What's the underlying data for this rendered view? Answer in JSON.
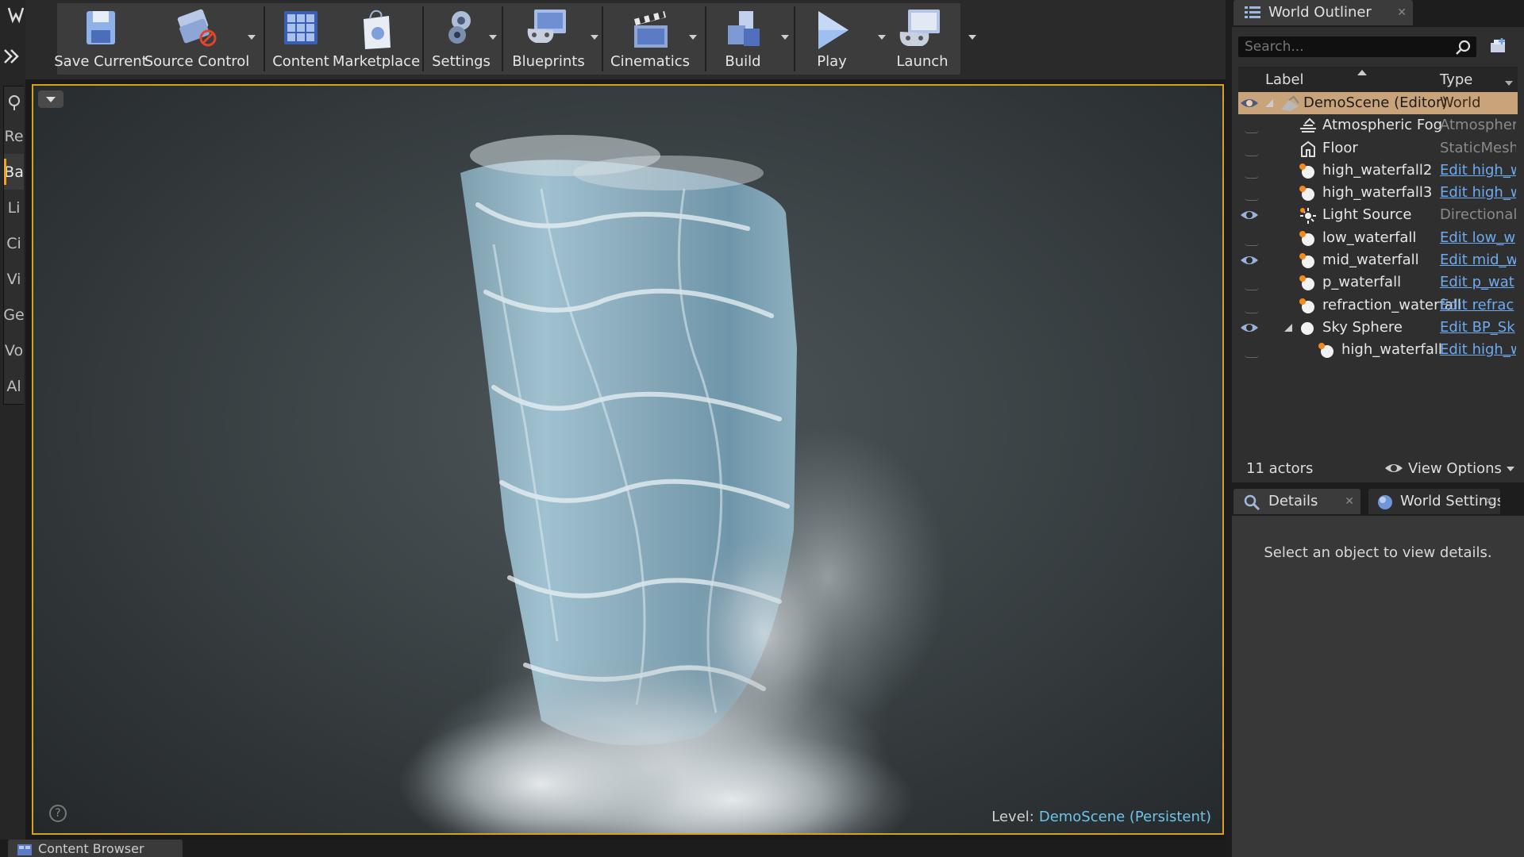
{
  "toolbar": {
    "save_current": "Save Current",
    "source_control": "Source Control",
    "content": "Content",
    "marketplace": "Marketplace",
    "settings": "Settings",
    "blueprints": "Blueprints",
    "cinematics": "Cinematics",
    "build": "Build",
    "play": "Play",
    "launch": "Launch"
  },
  "modes": {
    "tabs": [
      "Re",
      "Ba",
      "Li",
      "Ci",
      "Vi",
      "Ge",
      "Vo",
      "Al"
    ],
    "active_index": 1
  },
  "viewport": {
    "level_key": "Level:",
    "level_value": "DemoScene (Persistent)"
  },
  "bottom": {
    "content_browser_tab": "Content Browser"
  },
  "world_outliner": {
    "tab_title": "World Outliner",
    "search_placeholder": "Search...",
    "col_label": "Label",
    "col_type": "Type",
    "rows": [
      {
        "name": "DemoScene (Editor)",
        "type": "World",
        "link": false,
        "visible": true,
        "selected": true,
        "indent": 0,
        "expanded": true,
        "icon": "world-icon"
      },
      {
        "name": "Atmospheric Fog",
        "type": "Atmospheric",
        "link": false,
        "visible": false,
        "selected": false,
        "indent": 1,
        "icon": "fog-icon"
      },
      {
        "name": "Floor",
        "type": "StaticMesh",
        "link": false,
        "visible": false,
        "selected": false,
        "indent": 1,
        "icon": "mesh-icon"
      },
      {
        "name": "high_waterfall2",
        "type": "Edit high_w",
        "link": true,
        "visible": false,
        "selected": false,
        "indent": 1,
        "icon": "emitter-icon"
      },
      {
        "name": "high_waterfall3",
        "type": "Edit high_w",
        "link": true,
        "visible": false,
        "selected": false,
        "indent": 1,
        "icon": "emitter-icon"
      },
      {
        "name": "Light Source",
        "type": "Directional",
        "link": false,
        "visible": true,
        "selected": false,
        "indent": 1,
        "icon": "light-icon"
      },
      {
        "name": "low_waterfall",
        "type": "Edit low_w",
        "link": true,
        "visible": false,
        "selected": false,
        "indent": 1,
        "icon": "emitter-icon"
      },
      {
        "name": "mid_waterfall",
        "type": "Edit mid_w",
        "link": true,
        "visible": true,
        "selected": false,
        "indent": 1,
        "icon": "emitter-icon"
      },
      {
        "name": "p_waterfall",
        "type": "Edit p_wat",
        "link": true,
        "visible": false,
        "selected": false,
        "indent": 1,
        "icon": "emitter-icon"
      },
      {
        "name": "refraction_waterfall",
        "type": "Edit refrac",
        "link": true,
        "visible": false,
        "selected": false,
        "indent": 1,
        "icon": "emitter-icon"
      },
      {
        "name": "Sky Sphere",
        "type": "Edit BP_Sk",
        "link": true,
        "visible": true,
        "selected": false,
        "indent": 1,
        "expanded": true,
        "icon": "sphere-icon"
      },
      {
        "name": "high_waterfall",
        "type": "Edit high_w",
        "link": true,
        "visible": false,
        "selected": false,
        "indent": 2,
        "icon": "emitter-icon"
      }
    ],
    "actor_count": "11 actors",
    "view_options": "View Options"
  },
  "details_panel": {
    "tab_details": "Details",
    "tab_world_settings": "World Settings",
    "empty_message": "Select an object to view details."
  },
  "colors": {
    "viewport_border": "#d6a21a",
    "selected_row": "#c9a37a",
    "link": "#6eaaf0",
    "level_value": "#6ec3e8"
  }
}
